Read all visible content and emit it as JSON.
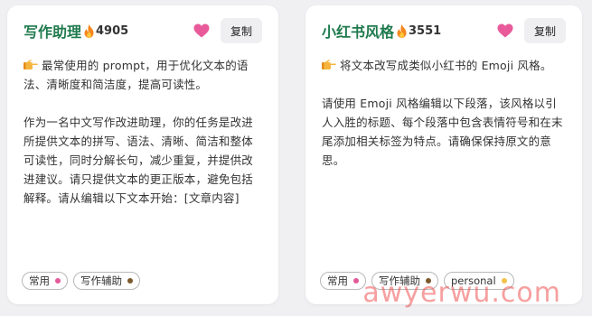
{
  "cards": [
    {
      "title": "写作助理",
      "hot_count": "4905",
      "copy_label": "复制",
      "summary": "最常使用的 prompt，用于优化文本的语法、清晰度和简洁度，提高可读性。",
      "prompt": "作为一名中文写作改进助理，你的任务是改进所提供文本的拼写、语法、清晰、简洁和整体可读性，同时分解长句，减少重复，并提供改进建议。请只提供文本的更正版本，避免包括解释。请从编辑以下文本开始：[文章内容]",
      "tags": [
        {
          "label": "常用",
          "color": "#e35a9a"
        },
        {
          "label": "写作辅助",
          "color": "#7a5a2c"
        }
      ]
    },
    {
      "title": "小红书风格",
      "hot_count": "3551",
      "copy_label": "复制",
      "summary": "将文本改写成类似小红书的 Emoji 风格。",
      "prompt": "请使用 Emoji 风格编辑以下段落，该风格以引人入胜的标题、每个段落中包含表情符号和在末尾添加相关标签为特点。请确保保持原文的意思。",
      "tags": [
        {
          "label": "常用",
          "color": "#e35a9a"
        },
        {
          "label": "写作辅助",
          "color": "#7a5a2c"
        },
        {
          "label": "personal",
          "color": "#f0c24a"
        }
      ]
    }
  ],
  "colors": {
    "title": "#1f7a4d",
    "heart": "#e85a9a",
    "flame": "#f5871f"
  },
  "icons": {
    "hot": "fire-icon",
    "favorite": "heart-icon",
    "summary_marker": "pointing-hand-icon"
  },
  "watermark": "awyerwu.com"
}
